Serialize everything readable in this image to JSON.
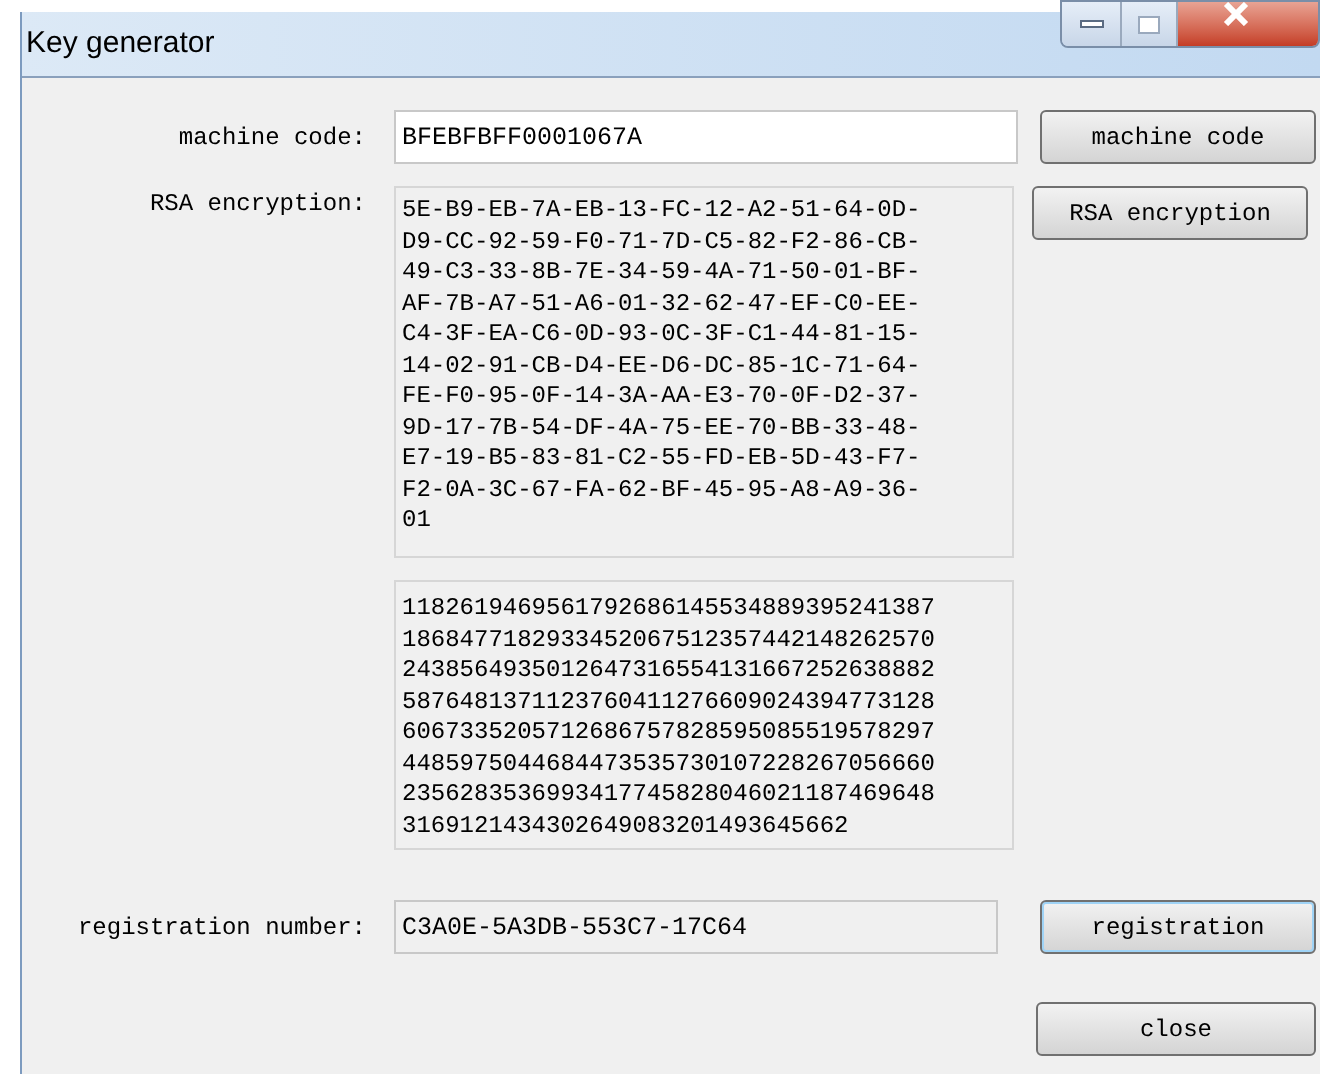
{
  "window": {
    "title": "Key generator"
  },
  "machine_code": {
    "label": "machine code:",
    "value": "BFEBFBFF0001067A",
    "button": "machine code"
  },
  "rsa": {
    "label": "RSA encryption:",
    "button": "RSA encryption",
    "hex_lines": [
      "5E-B9-EB-7A-EB-13-FC-12-A2-51-64-0D-",
      "D9-CC-92-59-F0-71-7D-C5-82-F2-86-CB-",
      "49-C3-33-8B-7E-34-59-4A-71-50-01-BF-",
      "AF-7B-A7-51-A6-01-32-62-47-EF-C0-EE-",
      "C4-3F-EA-C6-0D-93-0C-3F-C1-44-81-15-",
      "14-02-91-CB-D4-EE-D6-DC-85-1C-71-64-",
      "FE-F0-95-0F-14-3A-AA-E3-70-0F-D2-37-",
      "9D-17-7B-54-DF-4A-75-EE-70-BB-33-48-",
      "E7-19-B5-83-81-C2-55-FD-EB-5D-43-F7-",
      "F2-0A-3C-67-FA-62-BF-45-95-A8-A9-36-",
      "01"
    ],
    "decimal_lines": [
      "1182619469561792686145534889395241387",
      "1868477182933452067512357442148262570",
      "2438564935012647316554131667252638882",
      "5876481371123760411276609024394773128",
      "6067335205712686757828595085519578297",
      "4485975044684473535730107228267056660",
      "2356283536993417745828046021187469648",
      "3169121434302649083201493645662"
    ]
  },
  "registration": {
    "label": "registration number:",
    "value": "C3A0E-5A3DB-553C7-17C64",
    "button": "registration",
    "focused": true
  },
  "close_button": "close"
}
